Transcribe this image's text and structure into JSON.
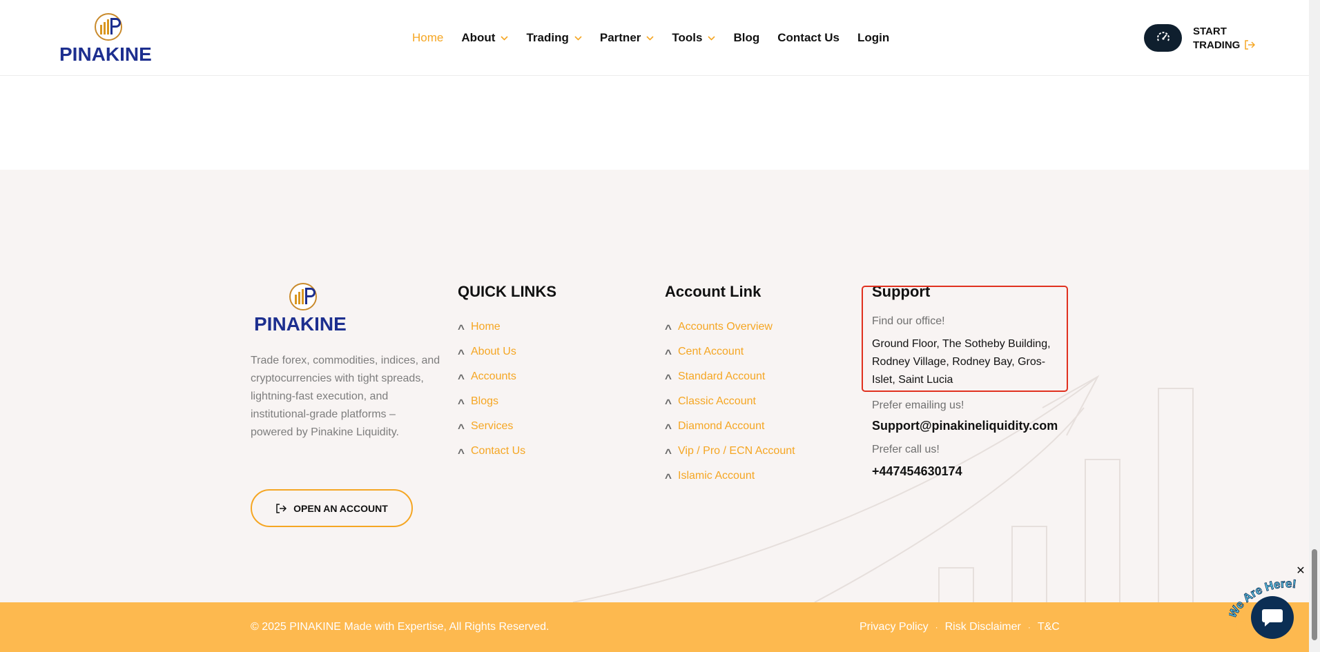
{
  "header": {
    "logo_text": "PINAKINE",
    "nav": [
      {
        "label": "Home",
        "active": true,
        "has_dropdown": false
      },
      {
        "label": "About",
        "active": false,
        "has_dropdown": true
      },
      {
        "label": "Trading",
        "active": false,
        "has_dropdown": true
      },
      {
        "label": "Partner",
        "active": false,
        "has_dropdown": true
      },
      {
        "label": "Tools",
        "active": false,
        "has_dropdown": true
      },
      {
        "label": "Blog",
        "active": false,
        "has_dropdown": false
      },
      {
        "label": "Contact Us",
        "active": false,
        "has_dropdown": false
      },
      {
        "label": "Login",
        "active": false,
        "has_dropdown": false
      }
    ],
    "start_trading_line1": "START",
    "start_trading_line2": "TRADING"
  },
  "footer": {
    "logo_text": "PINAKINE",
    "about_text": "Trade forex, commodities, indices, and cryptocurrencies with tight spreads, lightning-fast execution, and institutional-grade platforms – powered by Pinakine Liquidity.",
    "open_account_label": "OPEN AN ACCOUNT",
    "quick_links": {
      "title": "QUICK LINKS",
      "items": [
        "Home",
        "About Us",
        "Accounts",
        "Blogs",
        "Services",
        "Contact Us"
      ]
    },
    "account_links": {
      "title": "Account Link",
      "items": [
        "Accounts Overview",
        "Cent Account",
        "Standard Account",
        "Classic Account",
        "Diamond Account",
        "Vip / Pro / ECN Account",
        "Islamic Account"
      ]
    },
    "support": {
      "title": "Support",
      "office_label": "Find our office!",
      "address": "Ground Floor, The Sotheby Building, Rodney Village, Rodney Bay, Gros-Islet, Saint Lucia",
      "email_label": "Prefer emailing us!",
      "email": "Support@pinakineliquidity.com",
      "phone_label": "Prefer call us!",
      "phone": "+447454630174"
    }
  },
  "bottom_bar": {
    "copyright": "© 2025 PINAKINE Made with Expertise, All Rights Reserved.",
    "links": [
      "Privacy Policy",
      "Risk Disclaimer",
      "T&C"
    ]
  },
  "chat": {
    "badge_text": "We Are Here!",
    "close_symbol": "✕"
  },
  "colors": {
    "accent": "#f5a623",
    "bottom_bar": "#fdb94f",
    "footer_bg": "#f8f4f3",
    "navy": "#1d2f8f",
    "highlight": "#e0301e"
  }
}
